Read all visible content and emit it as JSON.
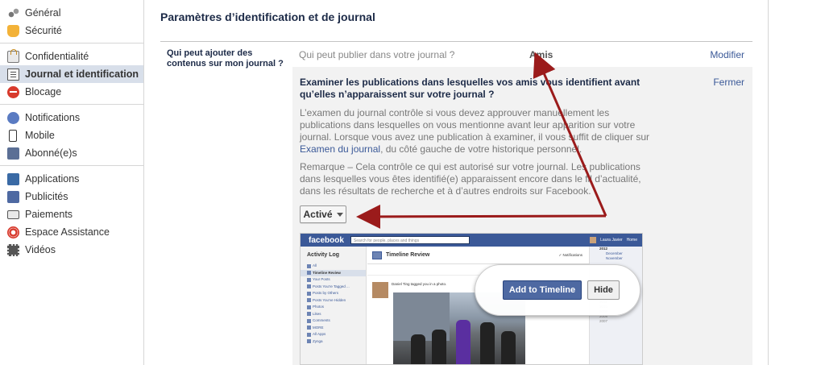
{
  "sidebar": {
    "groups": [
      [
        {
          "label": "Général",
          "icon": "gears-icon"
        },
        {
          "label": "Sécurité",
          "icon": "security-badge-icon"
        }
      ],
      [
        {
          "label": "Confidentialité",
          "icon": "privacy-lock-icon"
        },
        {
          "label": "Journal et identification",
          "icon": "timeline-icon",
          "active": true
        },
        {
          "label": "Blocage",
          "icon": "block-icon"
        }
      ],
      [
        {
          "label": "Notifications",
          "icon": "globe-icon"
        },
        {
          "label": "Mobile",
          "icon": "mobile-icon"
        },
        {
          "label": "Abonné(e)s",
          "icon": "rss-icon"
        }
      ],
      [
        {
          "label": "Applications",
          "icon": "apps-icon"
        },
        {
          "label": "Publicités",
          "icon": "ads-icon"
        },
        {
          "label": "Paiements",
          "icon": "payments-card-icon"
        },
        {
          "label": "Espace Assistance",
          "icon": "help-lifebuoy-icon"
        },
        {
          "label": "Vidéos",
          "icon": "video-film-icon"
        }
      ]
    ]
  },
  "main": {
    "title": "Paramètres d’identification et de journal",
    "row": {
      "label": "Qui peut ajouter des contenus sur mon journal ?",
      "question": "Qui peut publier dans votre journal ?",
      "value": "Amis",
      "edit_label": "Modifier"
    },
    "panel": {
      "heading": "Examiner les publications dans lesquelles vos amis vous identifient avant qu’elles n’apparaissent sur votre journal ?",
      "close_label": "Fermer",
      "para1_before": "L’examen du journal contrôle si vous devez approuver manuellement les publications dans lesquelles on vous mentionne avant leur apparition sur votre journal. Lorsque vous avez une publication à examiner, il vous suffit de cliquer sur ",
      "para1_link": "Examen du journal",
      "para1_after": ", du côté gauche de votre historique personnel.",
      "para2": "Remarque – Cela contrôle ce qui est autorisé sur votre journal. Les publications dans lesquelles vous êtes identifié(e) apparaissent encore dans le fil d’actualité, dans les résultats de recherche et à d’autres endroits sur Facebook.",
      "dropdown_value": "Activé"
    },
    "preview": {
      "logo": "facebook",
      "search_placeholder": "Search for people, places and things",
      "user": "Laura Javier",
      "home": "Home",
      "activity_log": "Activity Log",
      "side_items": [
        "All",
        "Timeline Review",
        "Your Posts",
        "Posts You're Tagged ...",
        "Posts by Others",
        "Posts You've Hidden",
        "Photos",
        "Likes",
        "Comments",
        "MORE",
        "All Apps",
        "Zynga"
      ],
      "timeline_review": "Timeline Review",
      "notifications": "✓ Notifications",
      "tag_text": "Daniel Ting tagged you in a photo.",
      "dates": [
        "2012",
        "December",
        "November",
        "2011",
        "2010",
        "2009",
        "2008",
        "2007"
      ],
      "add_button": "Add to Timeline",
      "hide_button": "Hide"
    }
  },
  "colors": {
    "brand": "#3b5998",
    "active_bg": "#d8dfea",
    "arrow": "#9b1b1b"
  }
}
